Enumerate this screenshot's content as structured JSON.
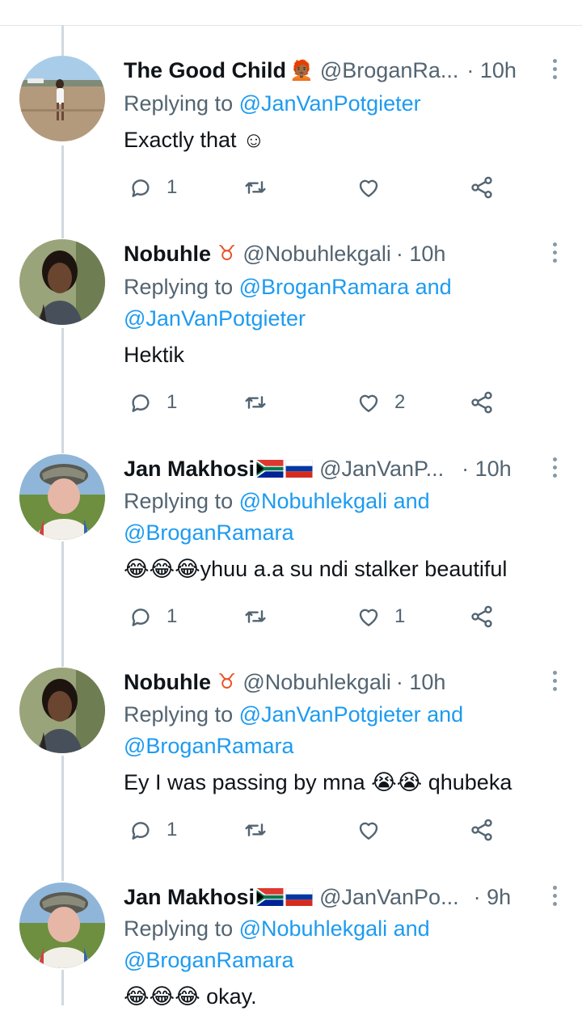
{
  "tweets": [
    {
      "name": "The Good Child",
      "name_emoji": "🧑🏾‍🦰",
      "handle": "@BroganRa...",
      "time": "· 10h",
      "reply_prefix": "Replying to ",
      "reply_line1": "@JanVanPotgieter",
      "reply_line2": "",
      "text": "Exactly that ☺",
      "replies": "1",
      "retweets": "",
      "likes": ""
    },
    {
      "name": "Nobuhle",
      "name_emoji": "♉",
      "handle": "@Nobuhlekgali",
      "time": "· 10h",
      "reply_prefix": "Replying to ",
      "reply_line1": "@BroganRamara and",
      "reply_line2": "@JanVanPotgieter",
      "text": "Hektik",
      "replies": "1",
      "retweets": "",
      "likes": "2"
    },
    {
      "name": "Jan Makhosi",
      "name_emoji": "",
      "handle": "@JanVanP...",
      "time": "· 10h",
      "reply_prefix": "Replying to ",
      "reply_line1": "@Nobuhlekgali and",
      "reply_line2": "@BroganRamara",
      "text": "😂😂😂yhuu a.a su ndi stalker beautiful",
      "replies": "1",
      "retweets": "",
      "likes": "1"
    },
    {
      "name": "Nobuhle",
      "name_emoji": "♉",
      "handle": "@Nobuhlekgali",
      "time": "· 10h",
      "reply_prefix": "Replying to ",
      "reply_line1": "@JanVanPotgieter and",
      "reply_line2": "@BroganRamara",
      "text": "Ey I was passing by mna 😭😭 qhubeka",
      "replies": "1",
      "retweets": "",
      "likes": ""
    },
    {
      "name": "Jan Makhosi",
      "name_emoji": "",
      "handle": "@JanVanPo...",
      "time": "· 9h",
      "reply_prefix": "Replying to ",
      "reply_line1": "@Nobuhlekgali and",
      "reply_line2": "@BroganRamara",
      "text": "😂😂😂 okay.",
      "replies": "",
      "retweets": "",
      "likes": ""
    }
  ],
  "colors": {
    "link": "#1d9bf0",
    "muted": "#536471",
    "thread_line": "#cfd9de"
  },
  "icons": [
    "reply-icon",
    "retweet-icon",
    "like-icon",
    "share-icon",
    "more-icon"
  ]
}
